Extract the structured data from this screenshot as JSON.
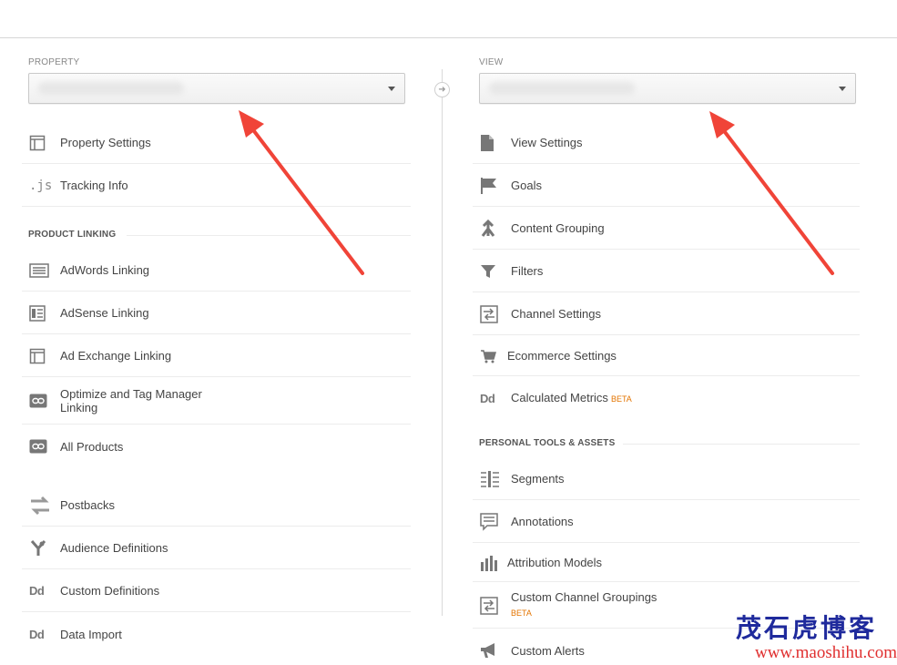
{
  "property": {
    "label": "PROPERTY",
    "items": [
      {
        "label": "Property Settings",
        "icon": "property-settings-icon"
      },
      {
        "label": "Tracking Info",
        "icon": "js-icon",
        "glyph": ".js"
      }
    ],
    "product_linking_heading": "PRODUCT LINKING",
    "linking_items": [
      {
        "label": "AdWords Linking",
        "icon": "adwords-icon"
      },
      {
        "label": "AdSense Linking",
        "icon": "adsense-icon"
      },
      {
        "label": "Ad Exchange Linking",
        "icon": "ad-exchange-icon"
      },
      {
        "label_line1": "Optimize and Tag Manager",
        "label_line2": "Linking",
        "icon": "link-icon"
      },
      {
        "label": "All Products",
        "icon": "link-icon"
      }
    ],
    "other_items": [
      {
        "label": "Postbacks",
        "icon": "postbacks-icon"
      },
      {
        "label": "Audience Definitions",
        "icon": "audience-icon"
      },
      {
        "label": "Custom Definitions",
        "icon": "dd-icon",
        "glyph": "Dd"
      },
      {
        "label": "Data Import",
        "icon": "dd-icon",
        "glyph": "Dd"
      }
    ]
  },
  "view": {
    "label": "VIEW",
    "items": [
      {
        "label": "View Settings",
        "icon": "document-icon"
      },
      {
        "label": "Goals",
        "icon": "flag-icon"
      },
      {
        "label": "Content Grouping",
        "icon": "content-grouping-icon"
      },
      {
        "label": "Filters",
        "icon": "filter-icon"
      },
      {
        "label": "Channel Settings",
        "icon": "channel-icon"
      },
      {
        "label": "Ecommerce Settings",
        "icon": "cart-icon"
      },
      {
        "label": "Calculated Metrics",
        "badge": "BETA",
        "icon": "dd-icon",
        "glyph": "Dd"
      }
    ],
    "personal_heading": "PERSONAL TOOLS & ASSETS",
    "personal_items": [
      {
        "label": "Segments",
        "icon": "segments-icon"
      },
      {
        "label": "Annotations",
        "icon": "annotations-icon"
      },
      {
        "label": "Attribution Models",
        "icon": "attribution-icon"
      },
      {
        "label": "Custom Channel Groupings",
        "badge": "BETA",
        "icon": "channel-icon"
      },
      {
        "label": "Custom Alerts",
        "icon": "megaphone-icon"
      }
    ]
  },
  "watermark": {
    "chinese": "茂石虎博客",
    "url": "www.maoshihu.com"
  },
  "colors": {
    "arrow": "#f04438",
    "beta": "#e37400"
  }
}
